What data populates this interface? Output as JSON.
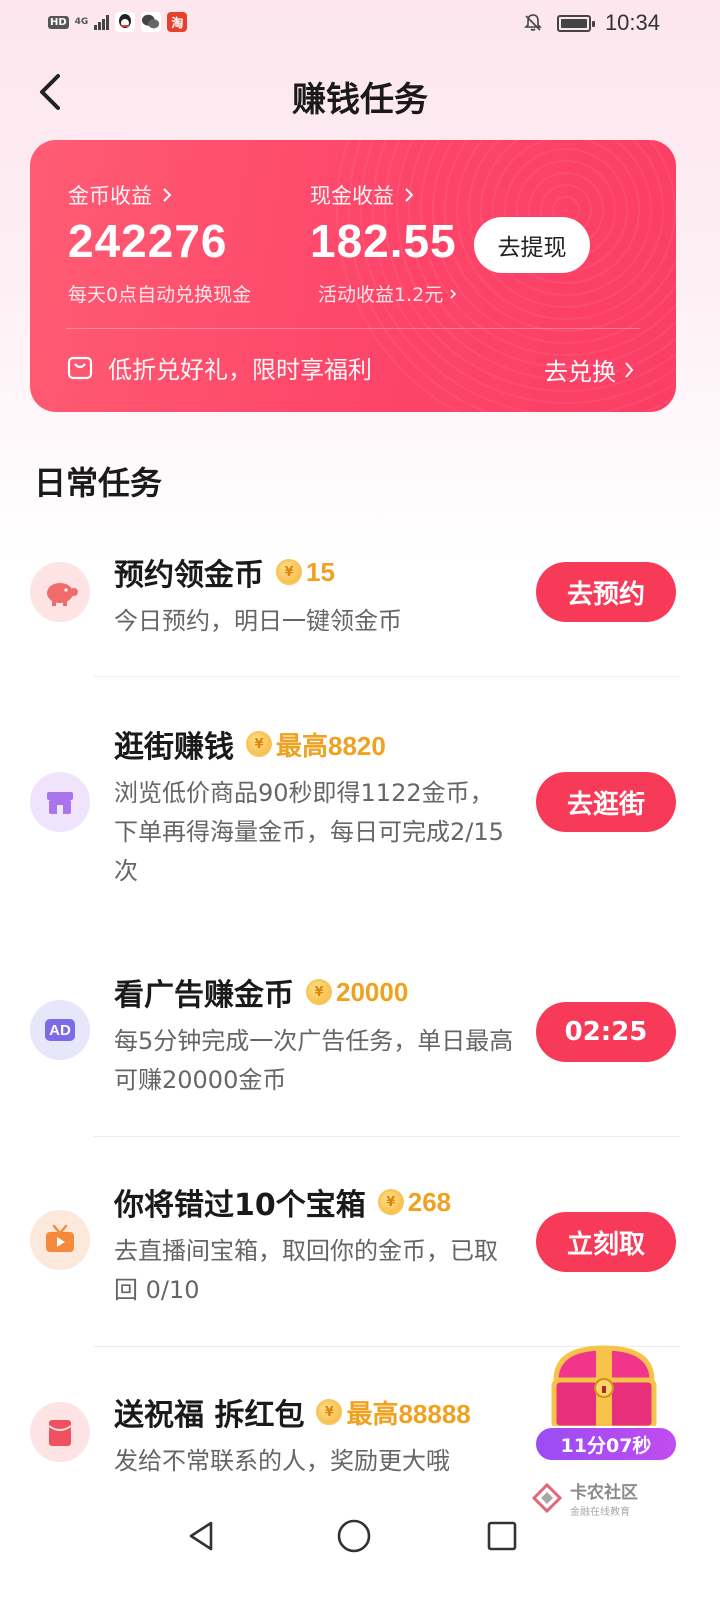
{
  "status_bar": {
    "left_badge": "HD",
    "network": "4G",
    "shop_icon_text": "淘",
    "time": "10:34"
  },
  "header": {
    "title": "赚钱任务"
  },
  "earnings_card": {
    "coin_label": "金币收益",
    "coin_value": "242276",
    "coin_sub": "每天0点自动兑换现金",
    "cash_label": "现金收益",
    "cash_value": "182.55",
    "cash_sub": "活动收益1.2元",
    "withdraw_label": "去提现",
    "promo_text": "低折兑好礼，限时享福利",
    "redeem_label": "去兑换"
  },
  "section_title": "日常任务",
  "tasks": [
    {
      "title": "预约领金币",
      "reward": "15",
      "desc": "今日预约，明日一键领金币",
      "button": "去预约",
      "icon": "piggy-bank-icon",
      "icon_bg": "#fde3e3",
      "icon_color": "#f06b6b"
    },
    {
      "title": "逛街赚钱",
      "reward": "最高8820",
      "desc": "浏览低价商品90秒即得1122金币，下单再得海量金币，每日可完成2/15次",
      "button": "去逛街",
      "icon": "store-icon",
      "icon_bg": "#efe4fb",
      "icon_color": "#a974ec"
    },
    {
      "title": "看广告赚金币",
      "reward": "20000",
      "desc": "每5分钟完成一次广告任务，单日最高可赚20000金币",
      "button": "02:25",
      "icon": "ad-icon",
      "icon_text": "AD",
      "icon_bg": "#e8e6fb",
      "icon_color": "#7c6ae8"
    },
    {
      "title": "你将错过10个宝箱",
      "reward": "268",
      "desc": "去直播间宝箱，取回你的金币，已取回 0/10",
      "button": "立刻取",
      "icon": "tv-icon",
      "icon_bg": "#fde9dc",
      "icon_color": "#f58a3c"
    },
    {
      "title": "送祝福 拆红包",
      "reward": "最高88888",
      "desc": "发给不常联系的人，奖励更大哦",
      "button": "",
      "icon": "red-envelope-icon",
      "icon_bg": "#fde3e3",
      "icon_color": "#f0505f"
    }
  ],
  "coin_symbol": "¥",
  "floating_chest": {
    "timer": "11分07秒"
  },
  "watermark": {
    "name": "卡农社区",
    "tagline": "金融在线教育"
  },
  "colors": {
    "accent": "#f83a59",
    "card": "#fd4569",
    "reward": "#f0a11f"
  }
}
